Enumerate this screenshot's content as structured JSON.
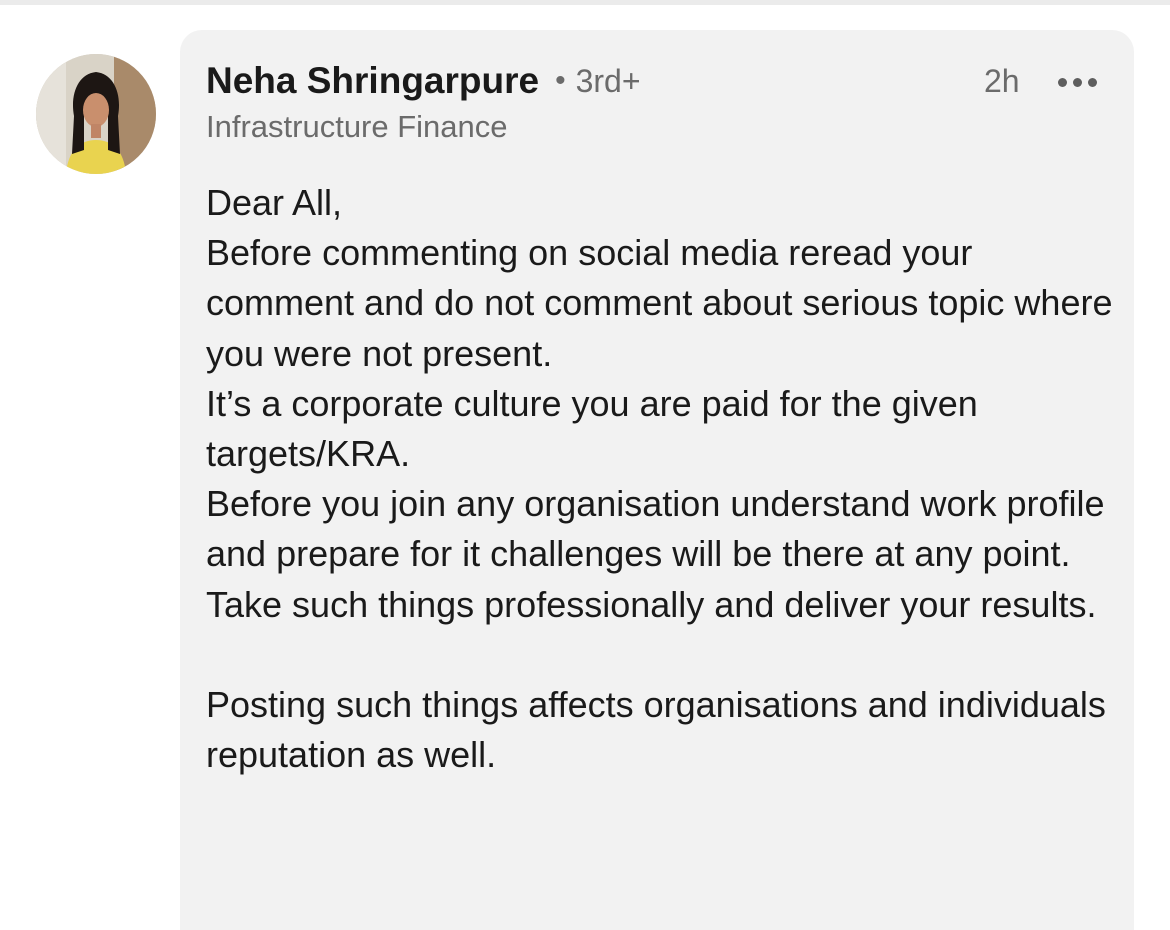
{
  "comment": {
    "author": {
      "name": "Neha Shringarpure",
      "separator": "•",
      "connection_degree": "3rd+",
      "headline": "Infrastructure Finance",
      "avatar_icon": "profile-photo"
    },
    "timestamp": "2h",
    "more_icon": "ellipsis-icon",
    "body": "Dear All,\nBefore commenting on social media reread your comment and do not comment about serious topic where you were not present.\nIt’s a corporate culture you are paid for the given targets/KRA.\nBefore you join any organisation understand work profile and prepare for it challenges will be there at any point.\nTake such things professionally and deliver your results.\n\nPosting such things affects organisations and individuals reputation as well."
  },
  "colors": {
    "bubble_background": "#f2f2f2",
    "primary_text": "#1a1a1a",
    "secondary_text": "#6b6b6b"
  }
}
